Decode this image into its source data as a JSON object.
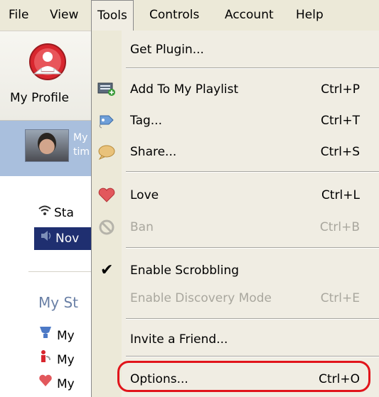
{
  "menubar": {
    "items": [
      "File",
      "View",
      "Tools",
      "Controls",
      "Account",
      "Help"
    ],
    "open_index": 2
  },
  "sidebar": {
    "profile_label": "My Profile",
    "user_text": [
      "My",
      "tim"
    ],
    "nav": [
      {
        "label": "Sta",
        "icon": "wifi-icon"
      },
      {
        "label": "Nov",
        "icon": "speaker-icon"
      }
    ],
    "section_title": "My St",
    "section_items": [
      {
        "label": "My",
        "icon": "trophy-icon"
      },
      {
        "label": "My",
        "icon": "info-icon"
      },
      {
        "label": "My",
        "icon": "heart-icon"
      }
    ]
  },
  "dropdown": {
    "items": [
      {
        "label": "Get Plugin...",
        "shortcut": "",
        "icon": "",
        "disabled": false
      },
      {
        "label": "Add To My Playlist",
        "shortcut": "Ctrl+P",
        "icon": "playlist-add-icon",
        "disabled": false
      },
      {
        "label": "Tag...",
        "shortcut": "Ctrl+T",
        "icon": "tag-icon",
        "disabled": false
      },
      {
        "label": "Share...",
        "shortcut": "Ctrl+S",
        "icon": "share-bubble-icon",
        "disabled": false
      },
      {
        "label": "Love",
        "shortcut": "Ctrl+L",
        "icon": "heart-icon",
        "disabled": false
      },
      {
        "label": "Ban",
        "shortcut": "Ctrl+B",
        "icon": "ban-icon",
        "disabled": true
      },
      {
        "label": "Enable Scrobbling",
        "shortcut": "",
        "icon": "checkmark-icon",
        "disabled": false,
        "checked": true
      },
      {
        "label": "Enable Discovery Mode",
        "shortcut": "Ctrl+E",
        "icon": "",
        "disabled": true
      },
      {
        "label": "Invite a Friend...",
        "shortcut": "",
        "icon": "",
        "disabled": false
      },
      {
        "label": "Options...",
        "shortcut": "Ctrl+O",
        "icon": "",
        "disabled": false,
        "highlighted": true
      }
    ]
  },
  "colors": {
    "menu_bg": "#f0ede3",
    "highlight_border": "#e1141b",
    "selected_nav": "#1f2f70",
    "user_bar": "#a9bfdd"
  }
}
